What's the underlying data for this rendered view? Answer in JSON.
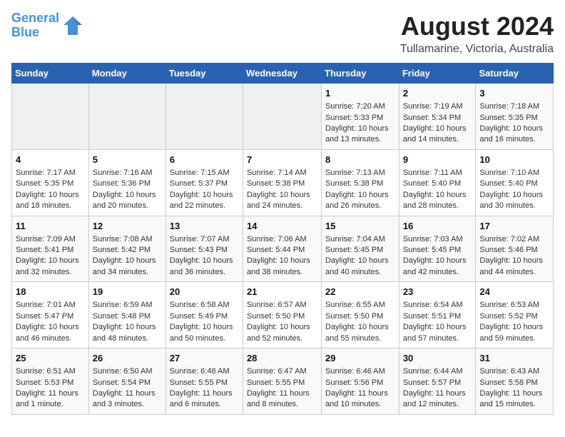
{
  "header": {
    "logo_line1": "General",
    "logo_line2": "Blue",
    "main_title": "August 2024",
    "subtitle": "Tullamarine, Victoria, Australia"
  },
  "weekdays": [
    "Sunday",
    "Monday",
    "Tuesday",
    "Wednesday",
    "Thursday",
    "Friday",
    "Saturday"
  ],
  "weeks": [
    [
      {
        "day": "",
        "content": ""
      },
      {
        "day": "",
        "content": ""
      },
      {
        "day": "",
        "content": ""
      },
      {
        "day": "",
        "content": ""
      },
      {
        "day": "1",
        "content": "Sunrise: 7:20 AM\nSunset: 5:33 PM\nDaylight: 10 hours\nand 13 minutes."
      },
      {
        "day": "2",
        "content": "Sunrise: 7:19 AM\nSunset: 5:34 PM\nDaylight: 10 hours\nand 14 minutes."
      },
      {
        "day": "3",
        "content": "Sunrise: 7:18 AM\nSunset: 5:35 PM\nDaylight: 10 hours\nand 16 minutes."
      }
    ],
    [
      {
        "day": "4",
        "content": "Sunrise: 7:17 AM\nSunset: 5:35 PM\nDaylight: 10 hours\nand 18 minutes."
      },
      {
        "day": "5",
        "content": "Sunrise: 7:16 AM\nSunset: 5:36 PM\nDaylight: 10 hours\nand 20 minutes."
      },
      {
        "day": "6",
        "content": "Sunrise: 7:15 AM\nSunset: 5:37 PM\nDaylight: 10 hours\nand 22 minutes."
      },
      {
        "day": "7",
        "content": "Sunrise: 7:14 AM\nSunset: 5:38 PM\nDaylight: 10 hours\nand 24 minutes."
      },
      {
        "day": "8",
        "content": "Sunrise: 7:13 AM\nSunset: 5:38 PM\nDaylight: 10 hours\nand 26 minutes."
      },
      {
        "day": "9",
        "content": "Sunrise: 7:11 AM\nSunset: 5:40 PM\nDaylight: 10 hours\nand 28 minutes."
      },
      {
        "day": "10",
        "content": "Sunrise: 7:10 AM\nSunset: 5:40 PM\nDaylight: 10 hours\nand 30 minutes."
      }
    ],
    [
      {
        "day": "11",
        "content": "Sunrise: 7:09 AM\nSunset: 5:41 PM\nDaylight: 10 hours\nand 32 minutes."
      },
      {
        "day": "12",
        "content": "Sunrise: 7:08 AM\nSunset: 5:42 PM\nDaylight: 10 hours\nand 34 minutes."
      },
      {
        "day": "13",
        "content": "Sunrise: 7:07 AM\nSunset: 5:43 PM\nDaylight: 10 hours\nand 36 minutes."
      },
      {
        "day": "14",
        "content": "Sunrise: 7:06 AM\nSunset: 5:44 PM\nDaylight: 10 hours\nand 38 minutes."
      },
      {
        "day": "15",
        "content": "Sunrise: 7:04 AM\nSunset: 5:45 PM\nDaylight: 10 hours\nand 40 minutes."
      },
      {
        "day": "16",
        "content": "Sunrise: 7:03 AM\nSunset: 5:45 PM\nDaylight: 10 hours\nand 42 minutes."
      },
      {
        "day": "17",
        "content": "Sunrise: 7:02 AM\nSunset: 5:46 PM\nDaylight: 10 hours\nand 44 minutes."
      }
    ],
    [
      {
        "day": "18",
        "content": "Sunrise: 7:01 AM\nSunset: 5:47 PM\nDaylight: 10 hours\nand 46 minutes."
      },
      {
        "day": "19",
        "content": "Sunrise: 6:59 AM\nSunset: 5:48 PM\nDaylight: 10 hours\nand 48 minutes."
      },
      {
        "day": "20",
        "content": "Sunrise: 6:58 AM\nSunset: 5:49 PM\nDaylight: 10 hours\nand 50 minutes."
      },
      {
        "day": "21",
        "content": "Sunrise: 6:57 AM\nSunset: 5:50 PM\nDaylight: 10 hours\nand 52 minutes."
      },
      {
        "day": "22",
        "content": "Sunrise: 6:55 AM\nSunset: 5:50 PM\nDaylight: 10 hours\nand 55 minutes."
      },
      {
        "day": "23",
        "content": "Sunrise: 6:54 AM\nSunset: 5:51 PM\nDaylight: 10 hours\nand 57 minutes."
      },
      {
        "day": "24",
        "content": "Sunrise: 6:53 AM\nSunset: 5:52 PM\nDaylight: 10 hours\nand 59 minutes."
      }
    ],
    [
      {
        "day": "25",
        "content": "Sunrise: 6:51 AM\nSunset: 5:53 PM\nDaylight: 11 hours\nand 1 minute."
      },
      {
        "day": "26",
        "content": "Sunrise: 6:50 AM\nSunset: 5:54 PM\nDaylight: 11 hours\nand 3 minutes."
      },
      {
        "day": "27",
        "content": "Sunrise: 6:48 AM\nSunset: 5:55 PM\nDaylight: 11 hours\nand 6 minutes."
      },
      {
        "day": "28",
        "content": "Sunrise: 6:47 AM\nSunset: 5:55 PM\nDaylight: 11 hours\nand 8 minutes."
      },
      {
        "day": "29",
        "content": "Sunrise: 6:46 AM\nSunset: 5:56 PM\nDaylight: 11 hours\nand 10 minutes."
      },
      {
        "day": "30",
        "content": "Sunrise: 6:44 AM\nSunset: 5:57 PM\nDaylight: 11 hours\nand 12 minutes."
      },
      {
        "day": "31",
        "content": "Sunrise: 6:43 AM\nSunset: 5:58 PM\nDaylight: 11 hours\nand 15 minutes."
      }
    ]
  ]
}
